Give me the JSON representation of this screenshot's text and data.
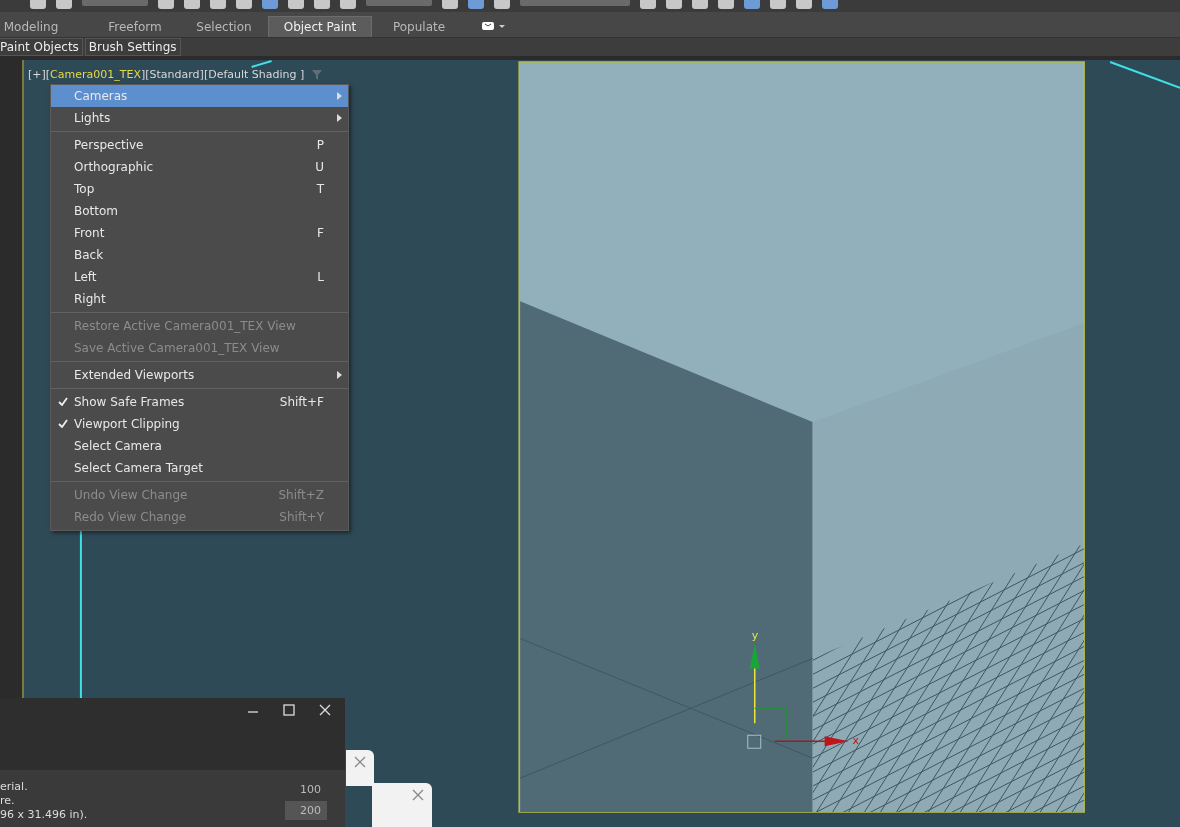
{
  "ribbon_tabs": [
    {
      "label": "Modeling",
      "selected": false
    },
    {
      "label": "Freeform",
      "selected": false
    },
    {
      "label": "Selection",
      "selected": false
    },
    {
      "label": "Object Paint",
      "selected": true
    },
    {
      "label": "Populate",
      "selected": false
    }
  ],
  "sub_tabs": [
    "Paint Objects",
    "Brush Settings"
  ],
  "viewport_label": {
    "prefix": "[+][",
    "camera": "Camera001_TEX",
    "suffix": "][Standard][Default Shading ]"
  },
  "menu": [
    {
      "kind": "item",
      "label": "Cameras",
      "submenu": true,
      "selected": true,
      "disabled": false,
      "checked": false
    },
    {
      "kind": "item",
      "label": "Lights",
      "submenu": true,
      "selected": false,
      "disabled": false,
      "checked": false
    },
    {
      "kind": "separator"
    },
    {
      "kind": "item",
      "label": "Perspective",
      "shortcut": "P",
      "selected": false,
      "disabled": false,
      "checked": false
    },
    {
      "kind": "item",
      "label": "Orthographic",
      "shortcut": "U",
      "selected": false,
      "disabled": false,
      "checked": false
    },
    {
      "kind": "item",
      "label": "Top",
      "shortcut": "T",
      "selected": false,
      "disabled": false,
      "checked": false
    },
    {
      "kind": "item",
      "label": "Bottom",
      "selected": false,
      "disabled": false,
      "checked": false
    },
    {
      "kind": "item",
      "label": "Front",
      "shortcut": "F",
      "selected": false,
      "disabled": false,
      "checked": false
    },
    {
      "kind": "item",
      "label": "Back",
      "selected": false,
      "disabled": false,
      "checked": false
    },
    {
      "kind": "item",
      "label": "Left",
      "shortcut": "L",
      "selected": false,
      "disabled": false,
      "checked": false
    },
    {
      "kind": "item",
      "label": "Right",
      "selected": false,
      "disabled": false,
      "checked": false
    },
    {
      "kind": "separator"
    },
    {
      "kind": "item",
      "label": "Restore Active Camera001_TEX View",
      "selected": false,
      "disabled": true,
      "checked": false
    },
    {
      "kind": "item",
      "label": "Save Active Camera001_TEX View",
      "selected": false,
      "disabled": true,
      "checked": false
    },
    {
      "kind": "separator"
    },
    {
      "kind": "item",
      "label": "Extended Viewports",
      "submenu": true,
      "selected": false,
      "disabled": false,
      "checked": false
    },
    {
      "kind": "separator"
    },
    {
      "kind": "item",
      "label": "Show Safe Frames",
      "shortcut": "Shift+F",
      "selected": false,
      "disabled": false,
      "checked": true
    },
    {
      "kind": "item",
      "label": "Viewport Clipping",
      "selected": false,
      "disabled": false,
      "checked": true
    },
    {
      "kind": "item",
      "label": "Select Camera",
      "selected": false,
      "disabled": false,
      "checked": false
    },
    {
      "kind": "item",
      "label": "Select Camera Target",
      "selected": false,
      "disabled": false,
      "checked": false
    },
    {
      "kind": "separator"
    },
    {
      "kind": "item",
      "label": "Undo View Change",
      "shortcut": "Shift+Z",
      "selected": false,
      "disabled": true,
      "checked": false
    },
    {
      "kind": "item",
      "label": "Redo View Change",
      "shortcut": "Shift+Y",
      "selected": false,
      "disabled": true,
      "checked": false
    }
  ],
  "gizmo": {
    "y_label": "y",
    "x_label": "x"
  },
  "dialog": {
    "lines": [
      "erial.",
      "re.",
      "96 x 31.496 in)."
    ],
    "values": [
      {
        "text": "100",
        "selected": false
      },
      {
        "text": "200",
        "selected": true
      }
    ]
  }
}
